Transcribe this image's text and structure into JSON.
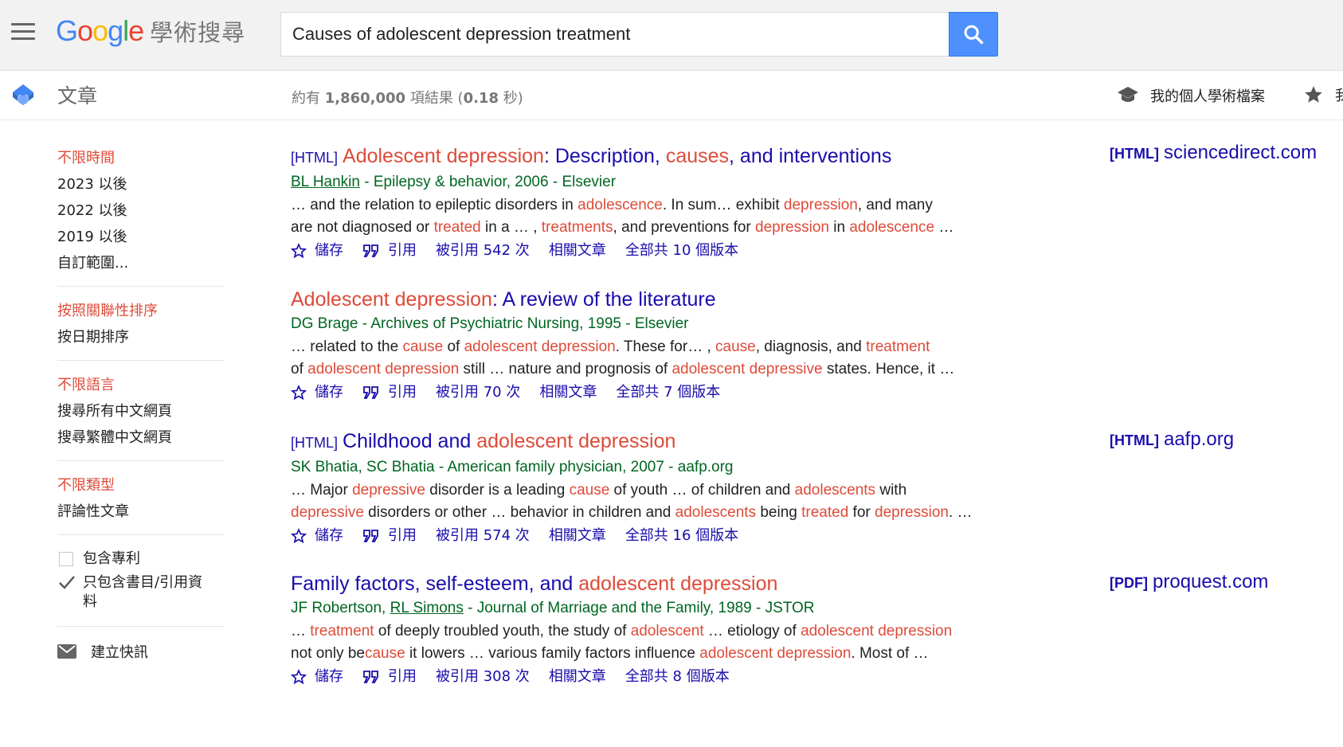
{
  "header": {
    "logo_text": "Google",
    "logo_suffix": "學術搜尋",
    "search_value": "Causes of adolescent depression treatment"
  },
  "subheader": {
    "section": "文章",
    "stats_prefix": "約有 ",
    "stats_count": "1,860,000",
    "stats_mid": " 項結果 (",
    "stats_time": "0.18",
    "stats_suffix": " 秒)",
    "profile_label": "我的個人學術檔案",
    "library_label": "我的圖書館"
  },
  "sidebar": {
    "time": [
      "不限時間",
      "2023 以後",
      "2022 以後",
      "2019 以後",
      "自訂範圍..."
    ],
    "sort": [
      "按照關聯性排序",
      "按日期排序"
    ],
    "lang": [
      "不限語言",
      "搜尋所有中文網頁",
      "搜尋繁體中文網頁"
    ],
    "type": [
      "不限類型",
      "評論性文章"
    ],
    "include_patents": "包含專利",
    "include_citations": "只包含書目/引用資料",
    "create_alert": "建立快訊"
  },
  "actions": {
    "save": "儲存",
    "cite": "引用",
    "related": "相關文章"
  },
  "results": [
    {
      "tag": "[HTML]",
      "title_parts": [
        [
          "Adolescent depression",
          true
        ],
        [
          ": Description, ",
          false
        ],
        [
          "causes",
          true
        ],
        [
          ", and interventions",
          false
        ]
      ],
      "authors": [
        [
          "BL Hankin",
          true
        ],
        [
          " - Epilepsy & behavior, 2006 - Elsevier",
          false
        ]
      ],
      "snippet": [
        [
          [
            "… and the relation to epileptic disorders in ",
            false
          ],
          [
            "adolescence",
            true
          ],
          [
            ". In sum… exhibit ",
            false
          ],
          [
            "depression",
            true
          ],
          [
            ", and many",
            false
          ]
        ],
        [
          [
            "are not diagnosed or ",
            false
          ],
          [
            "treated",
            true
          ],
          [
            " in a … , ",
            false
          ],
          [
            "treatments",
            true
          ],
          [
            ", and preventions for ",
            false
          ],
          [
            "depression",
            true
          ],
          [
            " in ",
            false
          ],
          [
            "adolescence",
            true
          ],
          [
            " …",
            false
          ]
        ]
      ],
      "cited_by": "被引用 542 次",
      "versions": "全部共 10 個版本",
      "side_tag": "[HTML]",
      "side_domain": "sciencedirect.com"
    },
    {
      "tag": "",
      "title_parts": [
        [
          "Adolescent depression",
          true
        ],
        [
          ": A review of the literature",
          false
        ]
      ],
      "authors": [
        [
          "DG Brage - Archives of Psychiatric Nursing, 1995 - Elsevier",
          false
        ]
      ],
      "snippet": [
        [
          [
            "… related to the ",
            false
          ],
          [
            "cause",
            true
          ],
          [
            " of ",
            false
          ],
          [
            "adolescent depression",
            true
          ],
          [
            ". These for… , ",
            false
          ],
          [
            "cause",
            true
          ],
          [
            ", diagnosis, and ",
            false
          ],
          [
            "treatment",
            true
          ]
        ],
        [
          [
            "of ",
            false
          ],
          [
            "adolescent depression",
            true
          ],
          [
            " still … nature and prognosis of ",
            false
          ],
          [
            "adolescent depressive",
            true
          ],
          [
            " states. Hence, it …",
            false
          ]
        ]
      ],
      "cited_by": "被引用 70 次",
      "versions": "全部共 7 個版本",
      "side_tag": "",
      "side_domain": ""
    },
    {
      "tag": "[HTML]",
      "title_parts": [
        [
          "Childhood and ",
          false
        ],
        [
          "adolescent depression",
          true
        ]
      ],
      "authors": [
        [
          "SK Bhatia, SC Bhatia - American family physician, 2007 - aafp.org",
          false
        ]
      ],
      "snippet": [
        [
          [
            "… Major ",
            false
          ],
          [
            "depressive",
            true
          ],
          [
            " disorder is a leading ",
            false
          ],
          [
            "cause",
            true
          ],
          [
            " of youth … of children and ",
            false
          ],
          [
            "adolescents",
            true
          ],
          [
            " with",
            false
          ]
        ],
        [
          [
            "depressive",
            true
          ],
          [
            " disorders or other … behavior in children and ",
            false
          ],
          [
            "adolescents",
            true
          ],
          [
            " being ",
            false
          ],
          [
            "treated",
            true
          ],
          [
            " for ",
            false
          ],
          [
            "depression",
            true
          ],
          [
            ". …",
            false
          ]
        ]
      ],
      "cited_by": "被引用 574 次",
      "versions": "全部共 16 個版本",
      "side_tag": "[HTML]",
      "side_domain": "aafp.org"
    },
    {
      "tag": "",
      "title_parts": [
        [
          "Family factors, self-esteem, and ",
          false
        ],
        [
          "adolescent depression",
          true
        ]
      ],
      "authors": [
        [
          "JF Robertson, ",
          false
        ],
        [
          "RL Simons",
          true
        ],
        [
          " - Journal of Marriage and the Family, 1989 - JSTOR",
          false
        ]
      ],
      "snippet": [
        [
          [
            "… ",
            false
          ],
          [
            "treatment",
            true
          ],
          [
            " of deeply troubled youth, the study of ",
            false
          ],
          [
            "adolescent",
            true
          ],
          [
            " … etiology of ",
            false
          ],
          [
            "adolescent depression",
            true
          ]
        ],
        [
          [
            "not only be",
            false
          ],
          [
            "cause",
            true
          ],
          [
            " it lowers … various family factors influence ",
            false
          ],
          [
            "adolescent depression",
            true
          ],
          [
            ". Most of …",
            false
          ]
        ]
      ],
      "cited_by": "被引用 308 次",
      "versions": "全部共 8 個版本",
      "side_tag": "[PDF]",
      "side_domain": "proquest.com"
    }
  ],
  "colors": {
    "link": "#1a0dab",
    "highlight": "#dd4b39",
    "green": "#006621",
    "search_blue": "#4d90fe"
  }
}
